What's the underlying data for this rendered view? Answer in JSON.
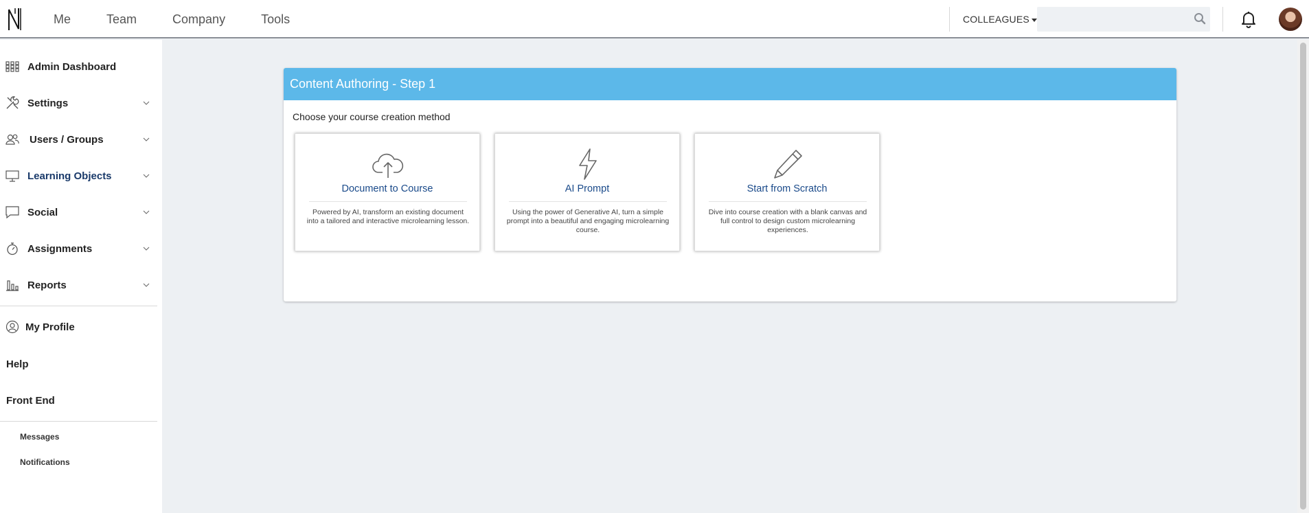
{
  "topnav": {
    "items": [
      "Me",
      "Team",
      "Company",
      "Tools"
    ]
  },
  "header": {
    "colleagues_label": "COLLEAGUES",
    "search_placeholder": ""
  },
  "sidebar": {
    "items": [
      {
        "label": "Admin Dashboard",
        "icon": "grid-icon"
      },
      {
        "label": "Settings",
        "icon": "tools-icon"
      },
      {
        "label": "Users / Groups",
        "icon": "users-icon"
      },
      {
        "label": "Learning Objects",
        "icon": "monitor-icon"
      },
      {
        "label": "Social",
        "icon": "chat-icon"
      },
      {
        "label": "Assignments",
        "icon": "stopwatch-icon"
      },
      {
        "label": "Reports",
        "icon": "bar-chart-icon"
      }
    ],
    "my_profile": "My Profile",
    "help": "Help",
    "front_end": "Front End",
    "messages": "Messages",
    "notifications": "Notifications"
  },
  "main": {
    "title": "Content Authoring - Step 1",
    "subtitle": "Choose your course creation method",
    "options": [
      {
        "title": "Document to Course",
        "icon": "cloud-upload-icon",
        "desc": "Powered by AI, transform an existing document into a tailored and interactive microlearning lesson."
      },
      {
        "title": "AI Prompt",
        "icon": "lightning-icon",
        "desc": "Using the power of Generative AI, turn a simple prompt into a beautiful and engaging microlearning course."
      },
      {
        "title": "Start from Scratch",
        "icon": "pencil-icon",
        "desc": "Dive into course creation with a blank canvas and full control to design custom microlearning experiences."
      }
    ]
  },
  "colors": {
    "header_blue": "#5cb8e9",
    "link_blue": "#1a4a8a",
    "page_bg": "#edf0f3"
  }
}
